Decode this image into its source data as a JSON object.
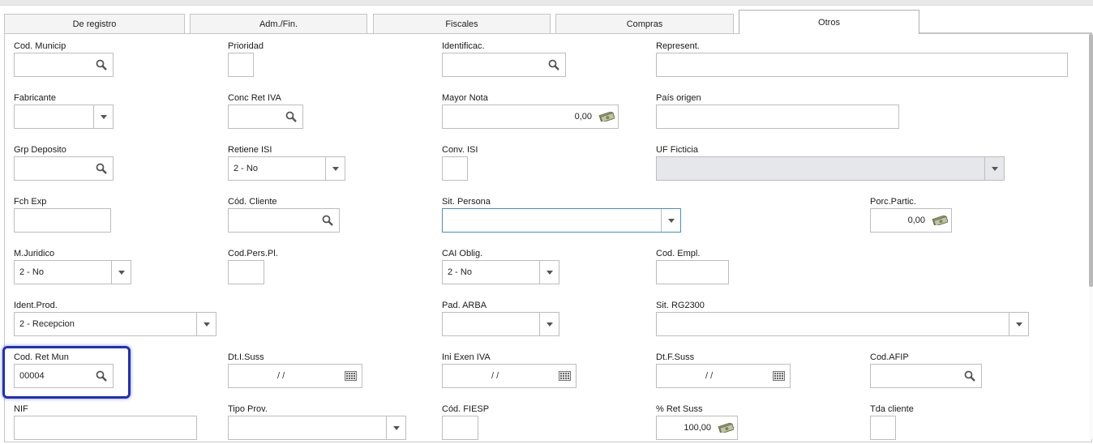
{
  "tabs": [
    "De registro",
    "Adm./Fin.",
    "Fiscales",
    "Compras",
    "Otros"
  ],
  "active_tab": "Otros",
  "fields": {
    "cod_municip": {
      "label": "Cod. Municip",
      "value": ""
    },
    "prioridad": {
      "label": "Prioridad",
      "value": ""
    },
    "identificac": {
      "label": "Identificac.",
      "value": ""
    },
    "represent": {
      "label": "Represent.",
      "value": ""
    },
    "fabricante": {
      "label": "Fabricante",
      "value": ""
    },
    "conc_ret_iva": {
      "label": "Conc Ret IVA",
      "value": ""
    },
    "mayor_nota": {
      "label": "Mayor Nota",
      "value": "0,00"
    },
    "pais_origen": {
      "label": "País origen",
      "value": ""
    },
    "grp_deposito": {
      "label": "Grp Deposito",
      "value": ""
    },
    "retiene_isi": {
      "label": "Retiene ISI",
      "value": "2 - No"
    },
    "conv_isi": {
      "label": "Conv. ISI",
      "value": ""
    },
    "uf_ficticia": {
      "label": "UF Ficticia",
      "value": ""
    },
    "fch_exp": {
      "label": "Fch Exp",
      "value": ""
    },
    "cod_cliente": {
      "label": "Cód. Cliente",
      "value": ""
    },
    "sit_persona": {
      "label": "Sit. Persona",
      "value": ""
    },
    "porc_partic": {
      "label": "Porc.Partic.",
      "value": "0,00"
    },
    "m_juridico": {
      "label": "M.Juridico",
      "value": "2 - No"
    },
    "cod_pers_pl": {
      "label": "Cod.Pers.Pl.",
      "value": ""
    },
    "cai_oblig": {
      "label": "CAI Oblig.",
      "value": "2 - No"
    },
    "cod_empl": {
      "label": "Cod. Empl.",
      "value": ""
    },
    "ident_prod": {
      "label": "Ident.Prod.",
      "value": "2 - Recepcion"
    },
    "pad_arba": {
      "label": "Pad. ARBA",
      "value": ""
    },
    "sit_rg2300": {
      "label": "Sit. RG2300",
      "value": ""
    },
    "cod_ret_mun": {
      "label": "Cod. Ret Mun",
      "value": "00004"
    },
    "dt_i_suss": {
      "label": "Dt.I.Suss",
      "value": "/ /"
    },
    "ini_exen_iva": {
      "label": "Ini Exen IVA",
      "value": "/ /"
    },
    "dt_f_suss": {
      "label": "Dt.F.Suss",
      "value": "/ /"
    },
    "cod_afip": {
      "label": "Cod.AFIP",
      "value": ""
    },
    "nif": {
      "label": "NIF",
      "value": ""
    },
    "tipo_prov": {
      "label": "Tipo Prov.",
      "value": ""
    },
    "cod_fiesp": {
      "label": "Cód. FIESP",
      "value": ""
    },
    "ret_suss": {
      "label": "% Ret Suss",
      "value": "100,00"
    },
    "tda_cliente": {
      "label": "Tda cliente",
      "value": ""
    }
  },
  "icons": {
    "search": "magnifier-icon",
    "money": "money-icon",
    "calendar": "calendar-icon",
    "dropdown": "chevron-down-icon"
  },
  "colors": {
    "highlight": "#1f2fc0",
    "focus": "#4a8dc7",
    "disabled": "#e6e7ea"
  }
}
